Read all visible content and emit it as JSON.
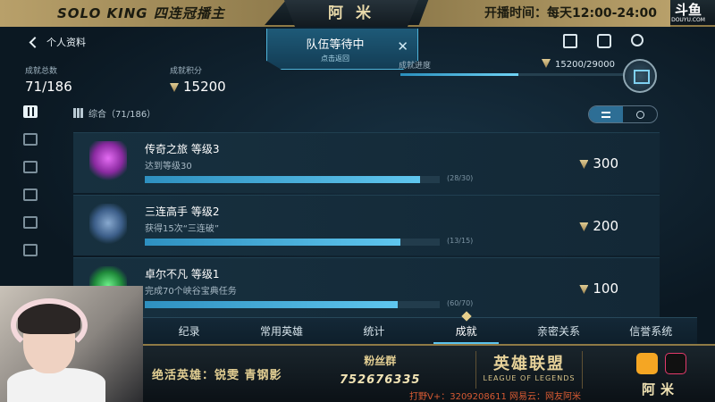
{
  "stream": {
    "left_title": "SOLO KING 四连冠播主",
    "center_name": "阿  米",
    "schedule": "开播时间：每天12:00-24:00",
    "platform_logo": "斗鱼",
    "platform_domain": "DOUYU.COM"
  },
  "game": {
    "back_label": "个人资料",
    "queue": {
      "title": "队伍等待中",
      "subtitle": "点击返回",
      "close": "✕"
    },
    "top_icons": [
      "clipboard-icon",
      "chat-icon",
      "friends-icon"
    ],
    "stats": {
      "total_label": "成就总数",
      "total_value": "71/186",
      "points_label": "成就积分",
      "points_value": "15200",
      "progress_label": "成就进度",
      "progress_value": "15200/29000",
      "progress_fraction": 0.524
    },
    "sidebar_icons": [
      "grid-icon",
      "profile-icon",
      "ranked-icon",
      "swords-icon",
      "cards-icon",
      "trophy-icon"
    ],
    "filter_label": "综合（71/186）",
    "achievements": [
      {
        "title": "传奇之旅  等级3",
        "desc": "达到等级30",
        "count": "(28/30)",
        "progress": 0.933,
        "points": "300"
      },
      {
        "title": "三连高手  等级2",
        "desc": "获得15次“三连破”",
        "count": "(13/15)",
        "progress": 0.867,
        "points": "200"
      },
      {
        "title": "卓尔不凡  等级1",
        "desc": "完成70个峡谷宝典任务",
        "count": "(60/70)",
        "progress": 0.857,
        "points": "100"
      }
    ],
    "tabs": [
      "纪录",
      "常用英雄",
      "统计",
      "成就",
      "亲密关系",
      "信誉系统"
    ],
    "active_tab": 3
  },
  "banner": {
    "heroes": "绝活英雄：锐雯  青钢影",
    "fans_label": "粉丝群",
    "fans_number": "752676335",
    "lol_cn": "英雄联盟",
    "lol_en": "LEAGUE OF LEGENDS",
    "streamer": "阿米",
    "contact": "打野V+：3209208611  网易云：网友阿米"
  },
  "colors": {
    "gold": "#c9b27a",
    "accent_blue": "#5cc3ee",
    "bar": "#2e90c0"
  }
}
